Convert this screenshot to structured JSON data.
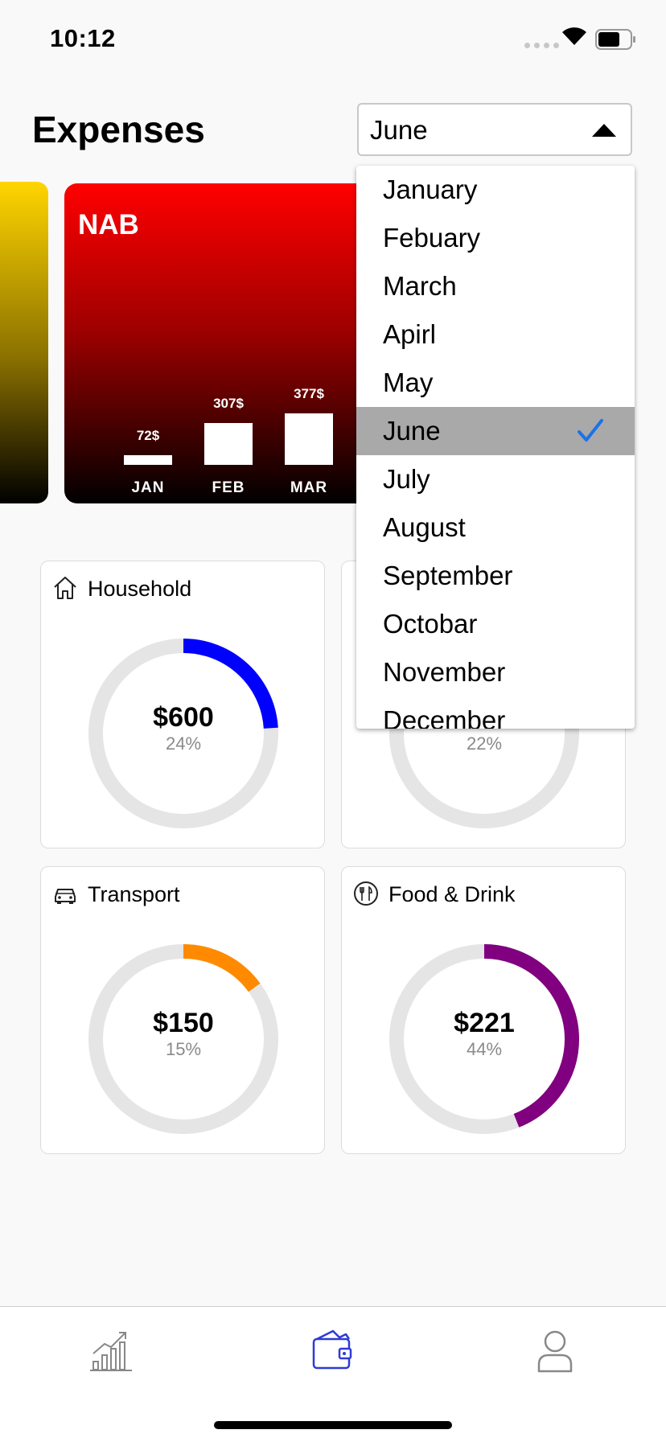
{
  "status_bar": {
    "time": "10:12"
  },
  "header": {
    "title": "Expenses"
  },
  "month_select": {
    "value": "June",
    "options": [
      "January",
      "Febuary",
      "March",
      "Apirl",
      "May",
      "June",
      "July",
      "August",
      "September",
      "Octobar",
      "November",
      "December"
    ],
    "selected_index": 5
  },
  "card": {
    "name": "NAB",
    "bars": [
      {
        "label": "JAN",
        "value_label": "72$",
        "value": 72
      },
      {
        "label": "FEB",
        "value_label": "307$",
        "value": 307
      },
      {
        "label": "MAR",
        "value_label": "377$",
        "value": 377
      }
    ],
    "colors": {
      "top": "#ff0000",
      "bottom": "#000000"
    }
  },
  "categories": [
    {
      "name": "Household",
      "icon": "house-icon",
      "amount": "$600",
      "percent_label": "24%",
      "percent": 24,
      "color": "#0000ff"
    },
    {
      "name": "",
      "icon": "",
      "amount": "",
      "percent_label": "22%",
      "percent": 22,
      "color": "#888888"
    },
    {
      "name": "Transport",
      "icon": "car-icon",
      "amount": "$150",
      "percent_label": "15%",
      "percent": 15,
      "color": "#ff8a00"
    },
    {
      "name": "Food & Drink",
      "icon": "fork-knife-icon",
      "amount": "$221",
      "percent_label": "44%",
      "percent": 44,
      "color": "#800080"
    }
  ],
  "tab_bar": {
    "items": [
      {
        "icon": "chart-icon",
        "active": false
      },
      {
        "icon": "wallet-icon",
        "active": true
      },
      {
        "icon": "profile-icon",
        "active": false
      }
    ],
    "active_color": "#2d3bd6"
  }
}
